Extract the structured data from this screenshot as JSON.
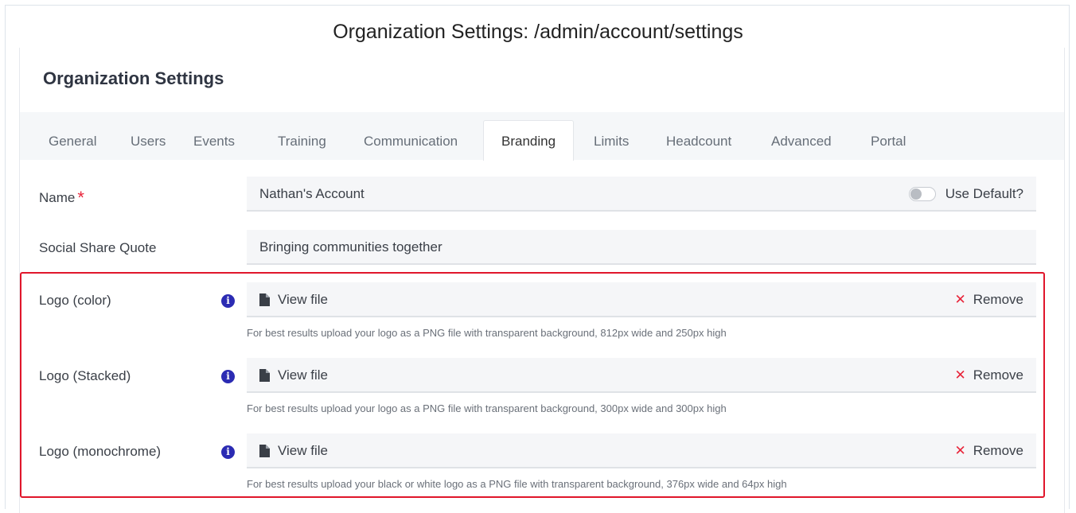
{
  "caption": "Organization Settings: /admin/account/settings",
  "card": {
    "title": "Organization Settings"
  },
  "tabs": [
    {
      "label": "General"
    },
    {
      "label": "Users"
    },
    {
      "label": "Events"
    },
    {
      "label": "Training"
    },
    {
      "label": "Communication"
    },
    {
      "label": "Branding",
      "active": true
    },
    {
      "label": "Limits"
    },
    {
      "label": "Headcount"
    },
    {
      "label": "Advanced"
    },
    {
      "label": "Portal"
    }
  ],
  "form": {
    "name": {
      "label": "Name",
      "required_marker": "*",
      "value": "Nathan's Account",
      "use_default_label": "Use Default?",
      "use_default_on": false
    },
    "social_share": {
      "label": "Social Share Quote",
      "value": "Bringing communities together"
    },
    "logos": [
      {
        "label": "Logo (color)",
        "view_label": "View file",
        "remove_label": "Remove",
        "help": "For best results upload your logo as a PNG file with transparent background, 812px wide and 250px high"
      },
      {
        "label": "Logo (Stacked)",
        "view_label": "View file",
        "remove_label": "Remove",
        "help": "For best results upload your logo as a PNG file with transparent background, 300px wide and 300px high"
      },
      {
        "label": "Logo (monochrome)",
        "view_label": "View file",
        "remove_label": "Remove",
        "help": "For best results upload your black or white logo as a PNG file with transparent background, 376px wide and 64px high"
      }
    ]
  },
  "icons": {
    "info": "info-icon",
    "file": "file-icon",
    "remove": "close-icon"
  },
  "colors": {
    "required": "#e8243a",
    "info_icon": "#2b2bb3",
    "remove_icon": "#e8243a",
    "highlight_border": "#e0162b"
  }
}
